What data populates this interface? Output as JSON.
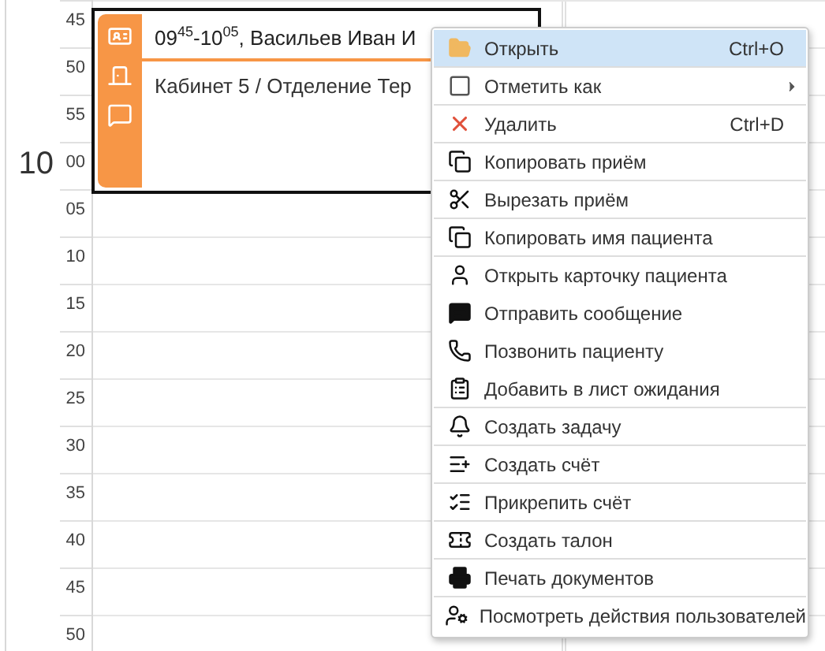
{
  "time_slots": [
    {
      "minute": "45"
    },
    {
      "minute": "50"
    },
    {
      "minute": "55"
    },
    {
      "hour": "10",
      "minute": "00"
    },
    {
      "minute": "05"
    },
    {
      "minute": "10"
    },
    {
      "minute": "15"
    },
    {
      "minute": "20"
    },
    {
      "minute": "25"
    },
    {
      "minute": "30"
    },
    {
      "minute": "35"
    },
    {
      "minute": "40"
    },
    {
      "minute": "45"
    },
    {
      "minute": "50"
    }
  ],
  "appointment": {
    "title": "09$^{45}$-10$^{05}$, Васильев Иван И",
    "location": "Кабинет 5 / Отделение Тер",
    "color": "#f79646"
  },
  "context_menu": [
    {
      "label": "Открыть",
      "shortcut": "Ctrl+O",
      "selected": true,
      "divider": true
    },
    {
      "label": "Отметить как",
      "submenu": true,
      "selected": false,
      "divider": true
    },
    {
      "label": "Удалить",
      "shortcut": "Ctrl+D",
      "selected": false,
      "divider": true
    },
    {
      "label": "Копировать приём",
      "selected": false,
      "divider": true
    },
    {
      "label": "Вырезать приём",
      "selected": false,
      "divider": true
    },
    {
      "label": "Копировать имя пациента",
      "selected": false,
      "divider": true
    },
    {
      "label": "Открыть карточку пациента",
      "selected": false,
      "divider": false
    },
    {
      "label": "Отправить сообщение",
      "selected": false,
      "divider": false
    },
    {
      "label": "Позвонить пациенту",
      "selected": false,
      "divider": false
    },
    {
      "label": "Добавить в лист ожидания",
      "selected": false,
      "divider": true
    },
    {
      "label": "Создать задачу",
      "selected": false,
      "divider": true
    },
    {
      "label": "Создать счёт",
      "selected": false,
      "divider": true
    },
    {
      "label": "Прикрепить счёт",
      "selected": false,
      "divider": true
    },
    {
      "label": "Создать талон",
      "selected": false,
      "divider": true
    },
    {
      "label": "Печать документов",
      "selected": false,
      "divider": true
    },
    {
      "label": "Посмотреть действия пользователей",
      "selected": false,
      "divider": false
    }
  ]
}
